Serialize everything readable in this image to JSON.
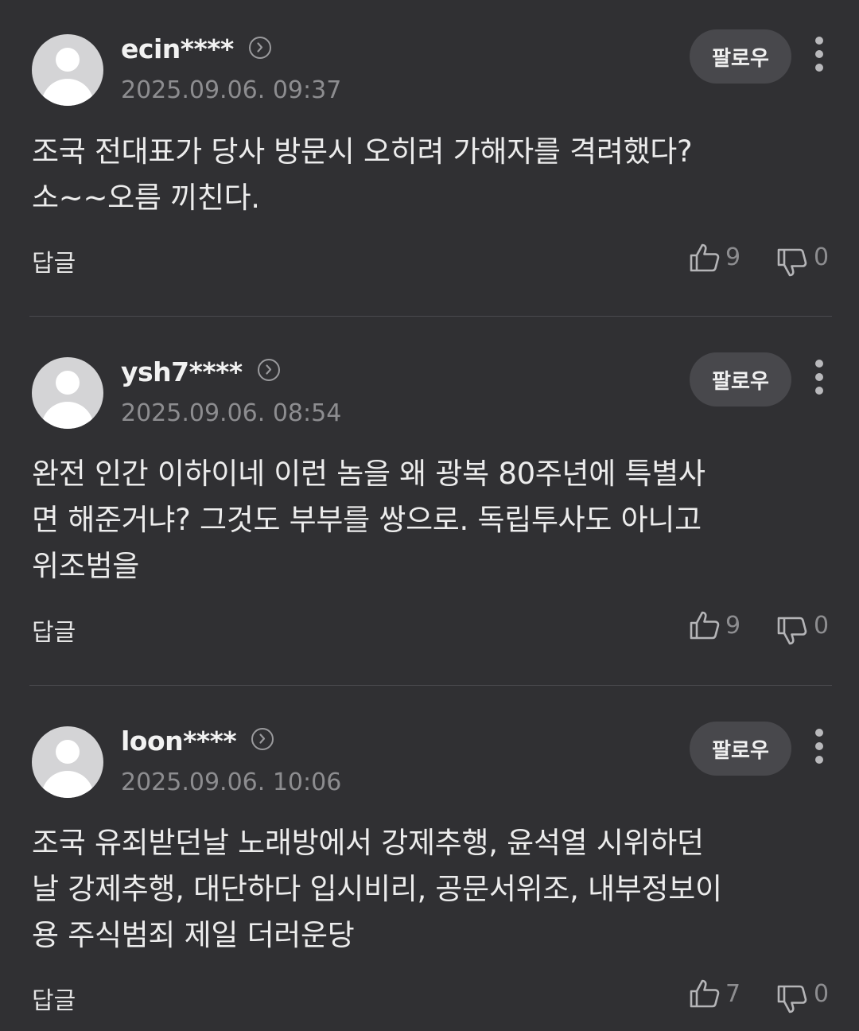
{
  "follow_label": "팔로우",
  "reply_label": "답글",
  "comments": [
    {
      "username": "ecin****",
      "timestamp": "2025.09.06. 09:37",
      "text": "조국 전대표가 당사 방문시 오히려 가해자를 격려했다?\n소~~오름 끼친다.",
      "likes": "9",
      "dislikes": "0"
    },
    {
      "username": "ysh7****",
      "timestamp": "2025.09.06. 08:54",
      "text": "완전 인간 이하이네 이런 놈을 왜 광복 80주년에 특별사\n면 해준거냐? 그것도 부부를 쌍으로. 독립투사도 아니고\n위조범을",
      "likes": "9",
      "dislikes": "0"
    },
    {
      "username": "loon****",
      "timestamp": "2025.09.06. 10:06",
      "text": "조국 유죄받던날 노래방에서 강제추행, 윤석열 시위하던\n날 강제추행, 대단하다 입시비리, 공문서위조, 내부정보이\n용 주식범죄 제일 더러운당",
      "likes": "7",
      "dislikes": "0"
    }
  ]
}
